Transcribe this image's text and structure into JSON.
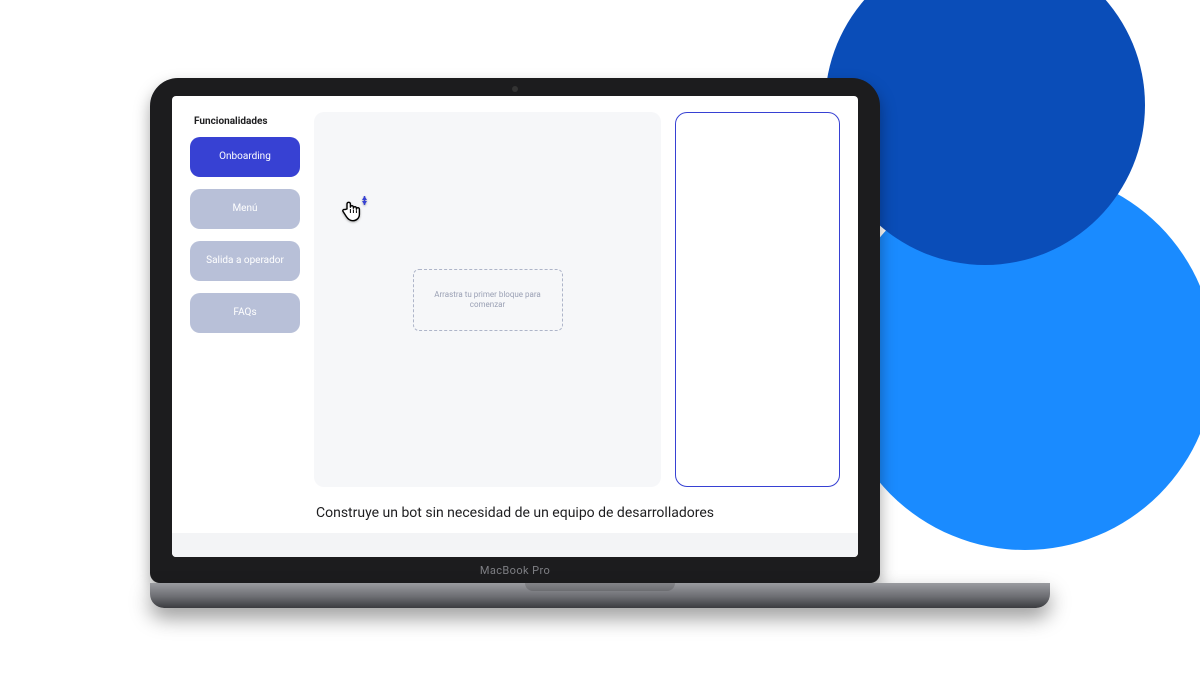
{
  "brand": "MacBook Pro",
  "sidebar": {
    "title": "Funcionalidades",
    "items": [
      {
        "label": "Onboarding",
        "state": "active"
      },
      {
        "label": "Menú",
        "state": "inactive"
      },
      {
        "label": "Salida a operador",
        "state": "inactive"
      },
      {
        "label": "FAQs",
        "state": "inactive"
      }
    ]
  },
  "canvas": {
    "dropzone_text": "Arrastra tu primer bloque para comenzar"
  },
  "caption": "Construye un bot sin necesidad de un equipo de desarrolladores",
  "colors": {
    "accent": "#3741d3",
    "accent_soft": "#b8c0d8",
    "bg_circle_dark": "#0a4db8",
    "bg_circle_light": "#1a8bff"
  }
}
